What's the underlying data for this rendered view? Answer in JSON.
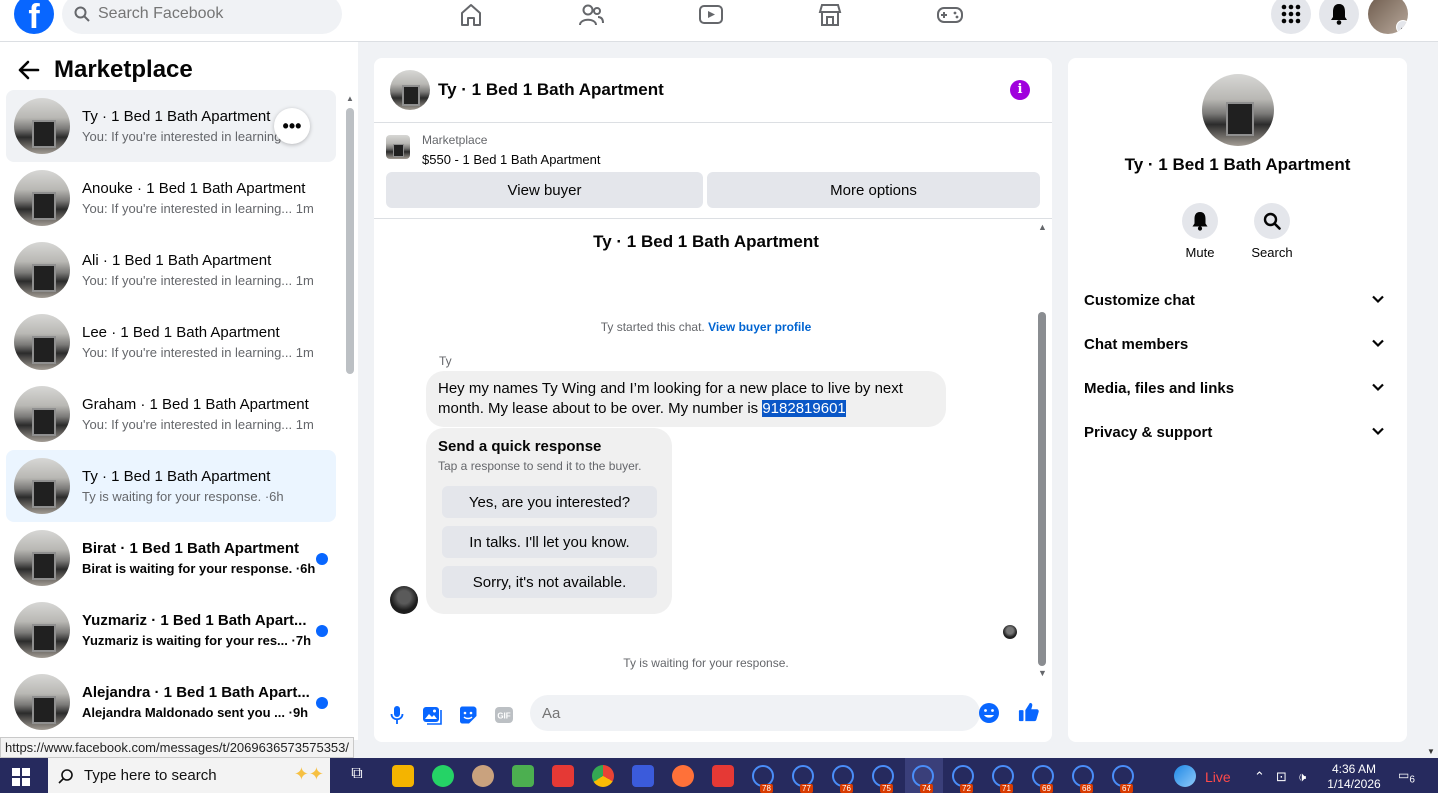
{
  "topbar": {
    "logo": "f",
    "search_placeholder": "Search Facebook",
    "nav_icons": [
      "home-icon",
      "friends-icon",
      "video-icon",
      "marketplace-icon",
      "gaming-icon"
    ],
    "right_icons": [
      "menu-grid-icon",
      "notifications-icon",
      "profile-avatar"
    ]
  },
  "sidebar": {
    "title": "Marketplace",
    "conversations": [
      {
        "title": "Ty · 1 Bed 1 Bath Apartment",
        "subtitle": "You: If you're interested in learning",
        "time": "",
        "state": "hover",
        "unread": false
      },
      {
        "title": "Anouke · 1 Bed 1 Bath Apartment",
        "subtitle": "You: If you're interested in learning...",
        "time": "1m",
        "state": "normal",
        "unread": false
      },
      {
        "title": "Ali · 1 Bed 1 Bath Apartment",
        "subtitle": "You: If you're interested in learning...",
        "time": "1m",
        "state": "normal",
        "unread": false
      },
      {
        "title": "Lee · 1 Bed 1 Bath Apartment",
        "subtitle": "You: If you're interested in learning...",
        "time": "1m",
        "state": "normal",
        "unread": false
      },
      {
        "title": "Graham · 1 Bed 1 Bath Apartment",
        "subtitle": "You: If you're interested in learning...",
        "time": "1m",
        "state": "normal",
        "unread": false
      },
      {
        "title": "Ty · 1 Bed 1 Bath Apartment",
        "subtitle": "Ty is waiting for your response.",
        "time": "6h",
        "state": "selected",
        "unread": false
      },
      {
        "title": "Birat · 1 Bed 1 Bath Apartment",
        "subtitle": "Birat is waiting for your response.",
        "time": "6h",
        "state": "normal",
        "unread": true
      },
      {
        "title": "Yuzmariz · 1 Bed 1 Bath Apart...",
        "subtitle": "Yuzmariz is waiting for your res...",
        "time": "7h",
        "state": "normal",
        "unread": true
      },
      {
        "title": "Alejandra · 1 Bed 1 Bath Apart...",
        "subtitle": "Alejandra Maldonado sent you ...",
        "time": "9h",
        "state": "normal",
        "unread": true
      }
    ],
    "more_label": "•••"
  },
  "chat": {
    "header_title": "Ty · 1 Bed 1 Bath Apartment",
    "listing_label": "Marketplace",
    "listing_title": "$550 - 1 Bed 1 Bath Apartment",
    "view_buyer": "View buyer",
    "more_options": "More options",
    "thread_title": "Ty · 1 Bed 1 Bath Apartment",
    "started_text": "Ty started this chat.",
    "view_profile": "View buyer profile",
    "sender": "Ty",
    "message_text": "Hey my names Ty Wing and I’m looking for a new place to live by next month. My lease about to be over. My number is ",
    "message_highlight": "9182819601",
    "quick_title": "Send a quick response",
    "quick_subtitle": "Tap a response to send it to the buyer.",
    "quick_replies": [
      "Yes, are you interested?",
      "In talks. I'll let you know.",
      "Sorry, it's not available."
    ],
    "waiting_text": "Ty is waiting for your response.",
    "composer_placeholder": "Aa"
  },
  "details": {
    "name": "Ty · 1 Bed 1 Bath Apartment",
    "mute": "Mute",
    "search": "Search",
    "sections": [
      "Customize chat",
      "Chat members",
      "Media, files and links",
      "Privacy & support"
    ]
  },
  "status_url": "https://www.facebook.com/messages/t/2069636573575353/",
  "taskbar": {
    "search_placeholder": "Type here to search",
    "badges": [
      "78",
      "77",
      "76",
      "75",
      "74",
      "72",
      "71",
      "69",
      "68",
      "67"
    ],
    "live": "Live",
    "time": "4:36 AM",
    "date": "1/14/2026",
    "notifications": "6"
  },
  "colors": {
    "accent": "#0866ff",
    "taskbar": "#262a5e",
    "info": "#a000dd"
  }
}
